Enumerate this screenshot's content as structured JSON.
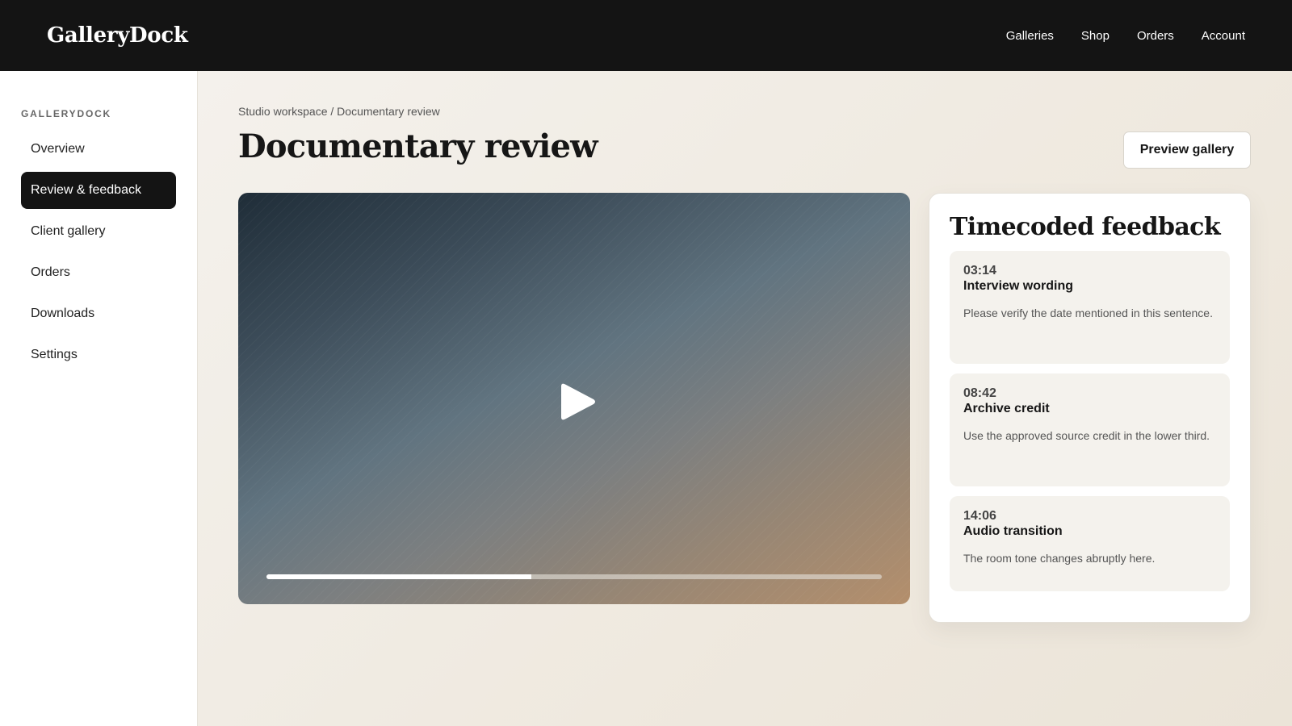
{
  "brand": "GalleryDock",
  "topnav": [
    "Galleries",
    "Shop",
    "Orders",
    "Account"
  ],
  "sidebar": {
    "caption": "GALLERYDOCK",
    "items": [
      {
        "label": "Overview",
        "active": false
      },
      {
        "label": "Review & feedback",
        "active": true
      },
      {
        "label": "Client gallery",
        "active": false
      },
      {
        "label": "Orders",
        "active": false
      },
      {
        "label": "Downloads",
        "active": false
      },
      {
        "label": "Settings",
        "active": false
      }
    ]
  },
  "main": {
    "breadcrumb": "Studio workspace / Documentary review",
    "title": "Documentary review",
    "preview_label": "Preview gallery"
  },
  "video": {
    "progress": 0.43,
    "icons": {
      "play": "play-icon"
    }
  },
  "feedback": {
    "title": "Timecoded feedback",
    "items": [
      {
        "time": "03:14",
        "title": "Interview wording",
        "body": "Please verify the date mentioned in this sentence."
      },
      {
        "time": "08:42",
        "title": "Archive credit",
        "body": "Use the approved source credit in the lower third."
      },
      {
        "time": "14:06",
        "title": "Audio transition",
        "body": "The room tone changes abruptly here."
      }
    ]
  },
  "colors": {
    "topbar": "#141414",
    "accent": "#141414",
    "background": "#f3efe8"
  }
}
